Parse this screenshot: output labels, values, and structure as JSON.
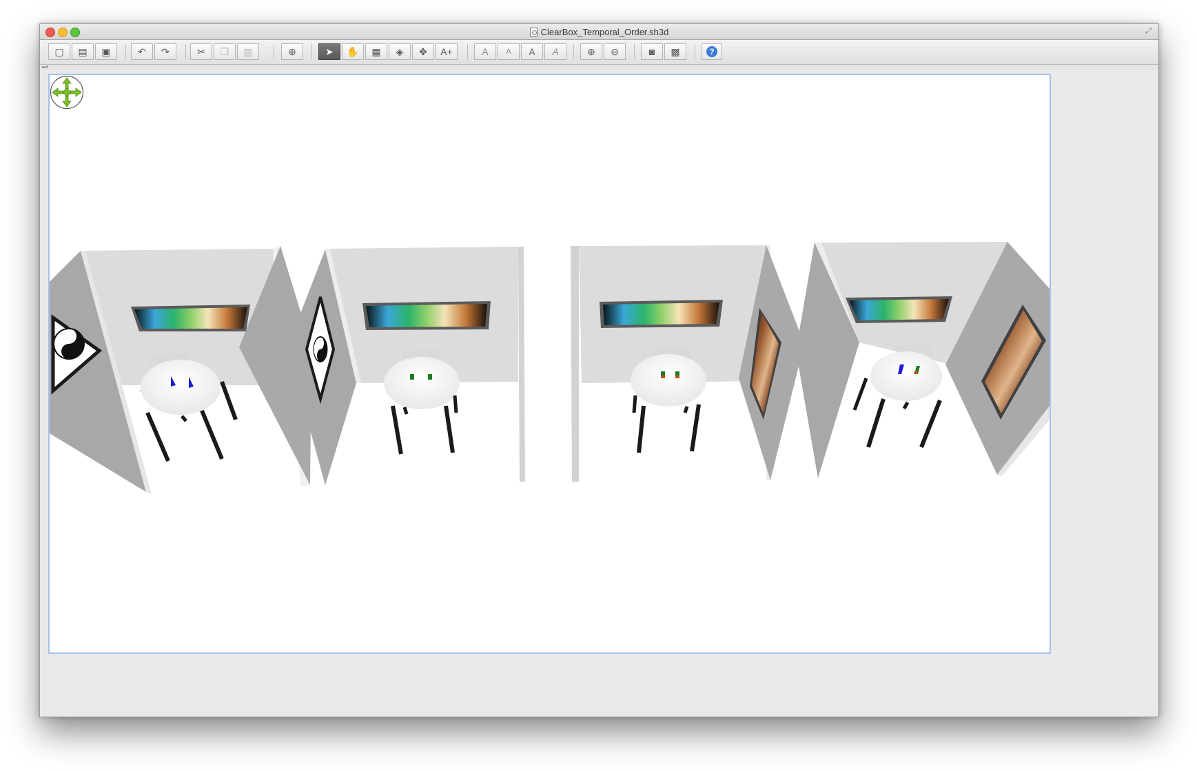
{
  "window": {
    "title": "ClearBox_Temporal_Order.sh3d"
  },
  "toolbar": {
    "file": [
      {
        "name": "new-home-button",
        "icon": "new-document-icon",
        "glyph": "▢"
      },
      {
        "name": "open-button",
        "icon": "folder-icon",
        "glyph": "▤"
      },
      {
        "name": "save-button",
        "icon": "save-icon",
        "glyph": "▣"
      }
    ],
    "edit": [
      {
        "name": "undo-button",
        "icon": "undo-icon",
        "glyph": "↶"
      },
      {
        "name": "redo-button",
        "icon": "redo-icon",
        "glyph": "↷"
      }
    ],
    "clipboard": [
      {
        "name": "cut-button",
        "icon": "scissors-icon",
        "glyph": "✂"
      },
      {
        "name": "copy-button",
        "icon": "copy-icon",
        "glyph": "❐"
      },
      {
        "name": "paste-button",
        "icon": "clipboard-icon",
        "glyph": "▥"
      }
    ],
    "furniture": [
      {
        "name": "add-furniture-button",
        "icon": "add-furniture-icon",
        "glyph": "⊕"
      }
    ],
    "modes": [
      {
        "name": "select-mode-button",
        "icon": "arrow-pointer-icon",
        "glyph": "➤",
        "selected": true
      },
      {
        "name": "pan-mode-button",
        "icon": "hand-icon",
        "glyph": "✋"
      },
      {
        "name": "create-walls-button",
        "icon": "walls-icon",
        "glyph": "▦"
      },
      {
        "name": "create-rooms-button",
        "icon": "rooms-icon",
        "glyph": "◈"
      },
      {
        "name": "create-dimensions-button",
        "icon": "dimension-icon",
        "glyph": "✥"
      },
      {
        "name": "add-text-button",
        "icon": "add-text-icon",
        "glyph": "A+"
      }
    ],
    "text_style": [
      {
        "name": "increase-text-size-button",
        "icon": "text-larger-icon",
        "glyph": "A"
      },
      {
        "name": "decrease-text-size-button",
        "icon": "text-smaller-icon",
        "glyph": "A"
      },
      {
        "name": "bold-text-button",
        "icon": "bold-icon",
        "glyph": "A"
      },
      {
        "name": "italic-text-button",
        "icon": "italic-icon",
        "glyph": "A"
      }
    ],
    "zoom": [
      {
        "name": "zoom-in-button",
        "icon": "zoom-in-icon",
        "glyph": "⊕"
      },
      {
        "name": "zoom-out-button",
        "icon": "zoom-out-icon",
        "glyph": "⊖"
      }
    ],
    "camera": [
      {
        "name": "create-photo-button",
        "icon": "camera-icon",
        "glyph": "◙"
      },
      {
        "name": "create-video-button",
        "icon": "video-icon",
        "glyph": "▩"
      }
    ],
    "help": [
      {
        "name": "help-button",
        "icon": "help-icon",
        "glyph": "?"
      }
    ]
  },
  "colors": {
    "selection_border": "#a6c2ea",
    "wall_light": "#dcdcdc",
    "wall_side": "#a9a9a9",
    "table_leg": "#1a1a1a",
    "nav_arrow": "#7cbf2a"
  }
}
